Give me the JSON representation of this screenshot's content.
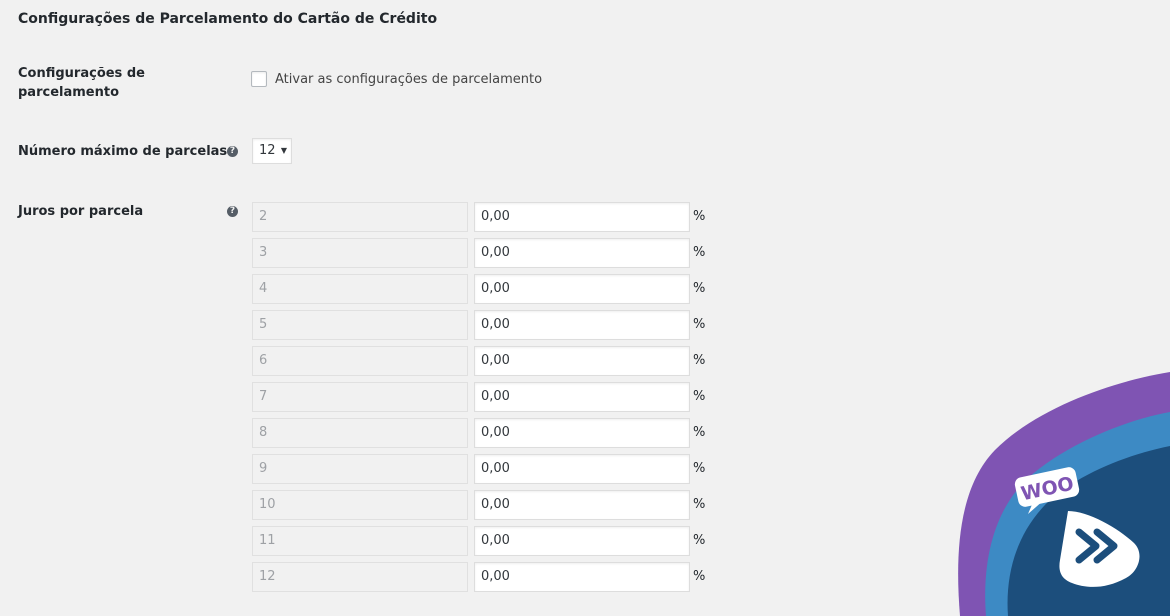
{
  "section_title": "Configurações de Parcelamento do Cartão de Crédito",
  "installment_settings": {
    "label_line1": "Configurações de",
    "label_line2": "parcelamento",
    "checkbox_label": "Ativar as configurações de parcelamento",
    "checked": false
  },
  "max_installments": {
    "label": "Número máximo de parcelas",
    "help_icon": "?",
    "selected": "12"
  },
  "interest": {
    "label": "Juros por parcela",
    "help_icon": "?",
    "percent_symbol": "%",
    "rows": [
      {
        "parcel": "2",
        "rate": "0,00"
      },
      {
        "parcel": "3",
        "rate": "0,00"
      },
      {
        "parcel": "4",
        "rate": "0,00"
      },
      {
        "parcel": "5",
        "rate": "0,00"
      },
      {
        "parcel": "6",
        "rate": "0,00"
      },
      {
        "parcel": "7",
        "rate": "0,00"
      },
      {
        "parcel": "8",
        "rate": "0,00"
      },
      {
        "parcel": "9",
        "rate": "0,00"
      },
      {
        "parcel": "10",
        "rate": "0,00"
      },
      {
        "parcel": "11",
        "rate": "0,00"
      },
      {
        "parcel": "12",
        "rate": "0,00"
      }
    ]
  },
  "badge": {
    "text": "WOO",
    "icon": "fast-forward-icon",
    "colors": {
      "purple": "#7f54b3",
      "light_blue": "#3d8ac4",
      "navy": "#1c4e7c",
      "white": "#ffffff"
    }
  }
}
